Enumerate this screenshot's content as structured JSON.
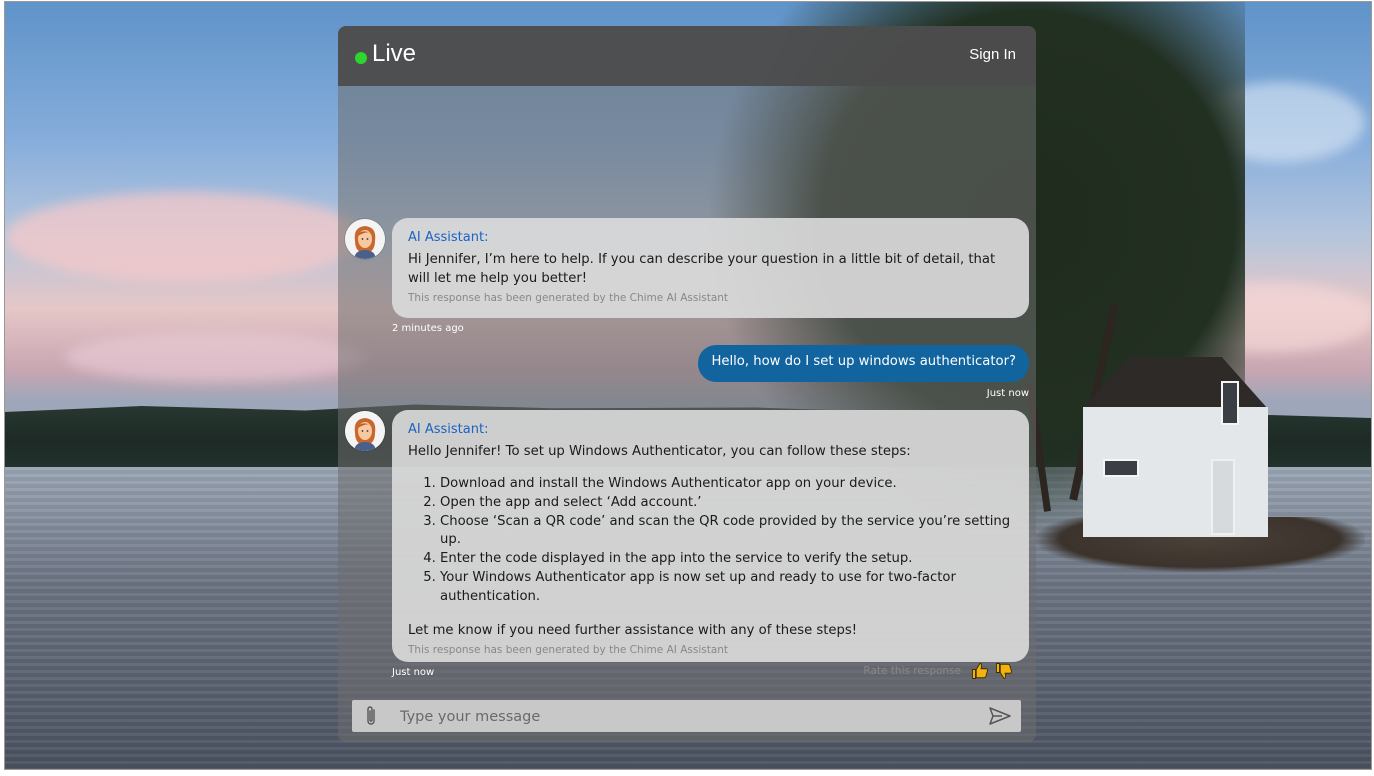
{
  "header": {
    "status_label": "Live",
    "sign_in_label": "Sign In"
  },
  "messages": [
    {
      "sender": "AI Assistant:",
      "text": "Hi Jennifer, I’m here to help. If you can describe your question in a little bit of detail, that will let me help you better!",
      "disclaimer": "This response has been generated by the Chime AI Assistant",
      "time": "2 minutes ago"
    },
    {
      "sender": "user",
      "text": "Hello, how do I set up windows authenticator?",
      "time": "Just now"
    },
    {
      "sender": "AI Assistant:",
      "intro": "Hello Jennifer! To set up Windows Authenticator, you can follow these steps:",
      "steps": [
        "Download and install the Windows Authenticator app on your device.",
        "Open the app and select ‘Add account.’",
        "Choose ‘Scan a QR code’ and scan the QR code provided by the service you’re setting up.",
        "Enter the code displayed in the app into the service to verify the setup.",
        "Your Windows Authenticator app is now set up and ready to use for two-factor authentication."
      ],
      "outro": "Let me know if you need further assistance with any of these steps!",
      "disclaimer": "This response has been generated by the Chime AI Assistant",
      "rate_label": "Rate this response",
      "time": "Just now"
    }
  ],
  "composer": {
    "placeholder": "Type your message"
  },
  "icons": {
    "status": "live-dot-icon",
    "avatar": "assistant-avatar",
    "rate_up": "thumbs-up-icon",
    "rate_down": "thumbs-down-icon",
    "attach": "paperclip-icon",
    "send": "send-icon"
  },
  "colors": {
    "live": "#2ed52e",
    "assistant_name": "#1b63c2",
    "user_bubble": "#12649e",
    "thumb": "#f2b40c"
  }
}
